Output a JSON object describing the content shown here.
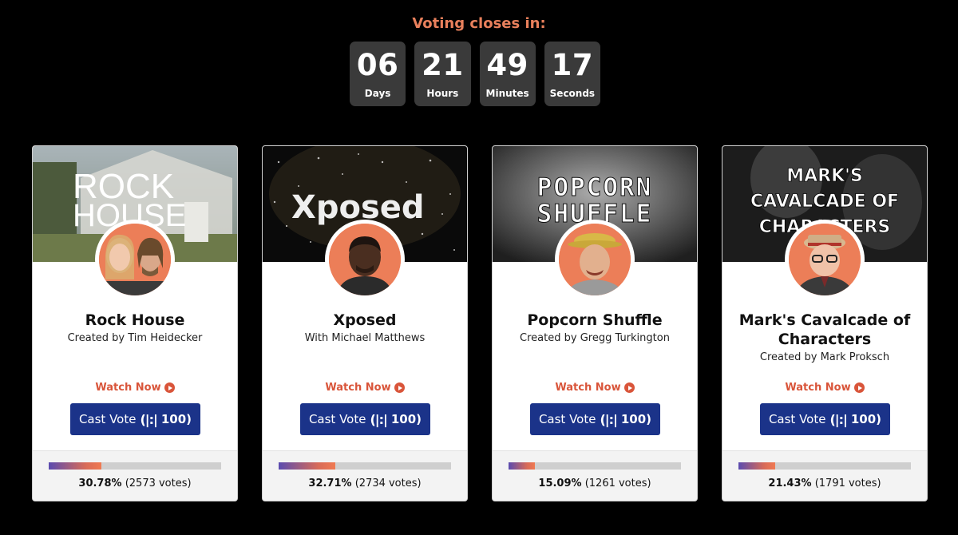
{
  "countdown": {
    "title": "Voting closes in:",
    "units": [
      {
        "value": "06",
        "label": "Days"
      },
      {
        "value": "21",
        "label": "Hours"
      },
      {
        "value": "49",
        "label": "Minutes"
      },
      {
        "value": "17",
        "label": "Seconds"
      }
    ]
  },
  "colors": {
    "accent": "#e9805c",
    "button": "#1b3389",
    "watch": "#d9553a"
  },
  "cards": [
    {
      "title": "Rock House",
      "subtitle": "Created by Tim Heidecker",
      "banner_text": [
        "ROCK",
        "HOUSE"
      ],
      "watch_label": "Watch Now",
      "vote_label": "Cast Vote",
      "vote_icon": "(|:|",
      "vote_cost": "100)",
      "percent_value": 30.78,
      "percent": "30.78%",
      "votes": "(2573 votes)"
    },
    {
      "title": "Xposed",
      "subtitle": "With Michael Matthews",
      "banner_text": [
        "Xposed"
      ],
      "watch_label": "Watch Now",
      "vote_label": "Cast Vote",
      "vote_icon": "(|:|",
      "vote_cost": "100)",
      "percent_value": 32.71,
      "percent": "32.71%",
      "votes": "(2734 votes)"
    },
    {
      "title": "Popcorn Shuffle",
      "subtitle": "Created by Gregg Turkington",
      "banner_text": [
        "POPCORN",
        "SHUFFLE"
      ],
      "watch_label": "Watch Now",
      "vote_label": "Cast Vote",
      "vote_icon": "(|:|",
      "vote_cost": "100)",
      "percent_value": 15.09,
      "percent": "15.09%",
      "votes": "(1261 votes)"
    },
    {
      "title": "Mark's Cavalcade of Characters",
      "subtitle": "Created by Mark Proksch",
      "banner_text": [
        "MARK'S",
        "CAVALCADE OF",
        "CHARACTERS"
      ],
      "watch_label": "Watch Now",
      "vote_label": "Cast Vote",
      "vote_icon": "(|:|",
      "vote_cost": "100)",
      "percent_value": 21.43,
      "percent": "21.43%",
      "votes": "(1791 votes)"
    }
  ]
}
